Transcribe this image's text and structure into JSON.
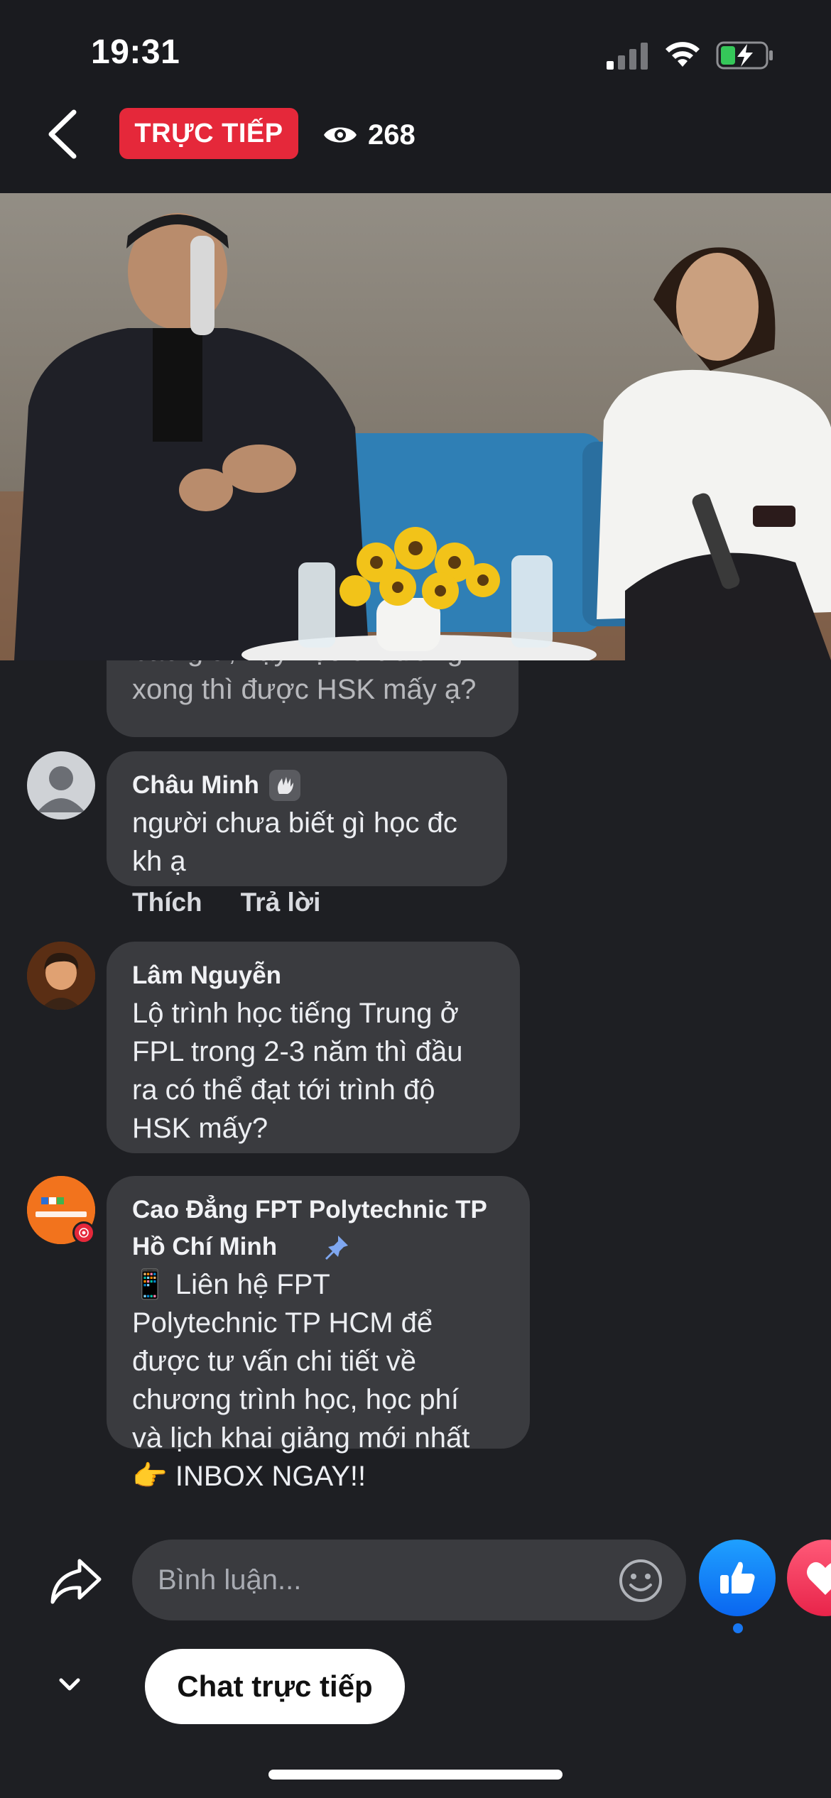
{
  "status_bar": {
    "time": "19:31"
  },
  "header": {
    "live_label": "TRỰC TIẾP",
    "viewer_count": "268"
  },
  "comments": [
    {
      "name": "",
      "text": "bao giờ, vậy học ở trường\nxong thì được HSK mấy ạ?"
    },
    {
      "name": "Châu Minh",
      "text": "người chưa biết gì học đc\nkh ạ",
      "badge": "wave-icon"
    },
    {
      "name": "Lâm Nguyễn",
      "text": "Lộ trình học tiếng Trung ở\nFPL trong 2-3 năm thì đầu\nra có thể đạt tới trình độ\nHSK mấy?"
    },
    {
      "name": "Cao Đẳng FPT Polytechnic TP\nHồ Chí Minh",
      "text": "📱 Liên hệ FPT\nPolytechnic TP HCM để\nđược tư vấn chi tiết về\nchương trình học, học phí\nvà lịch khai giảng mới nhất\n👉 INBOX NGAY!!",
      "badge": "pin-icon"
    }
  ],
  "comment_actions": {
    "like": "Thích",
    "reply": "Trả lời"
  },
  "composer": {
    "placeholder": "Bình luận...",
    "chat_live": "Chat trực tiếp"
  },
  "colors": {
    "live_red": "#e5283a",
    "like_blue": "#1877f2",
    "bubble": "#3a3b3f",
    "background": "#1e1f23"
  }
}
